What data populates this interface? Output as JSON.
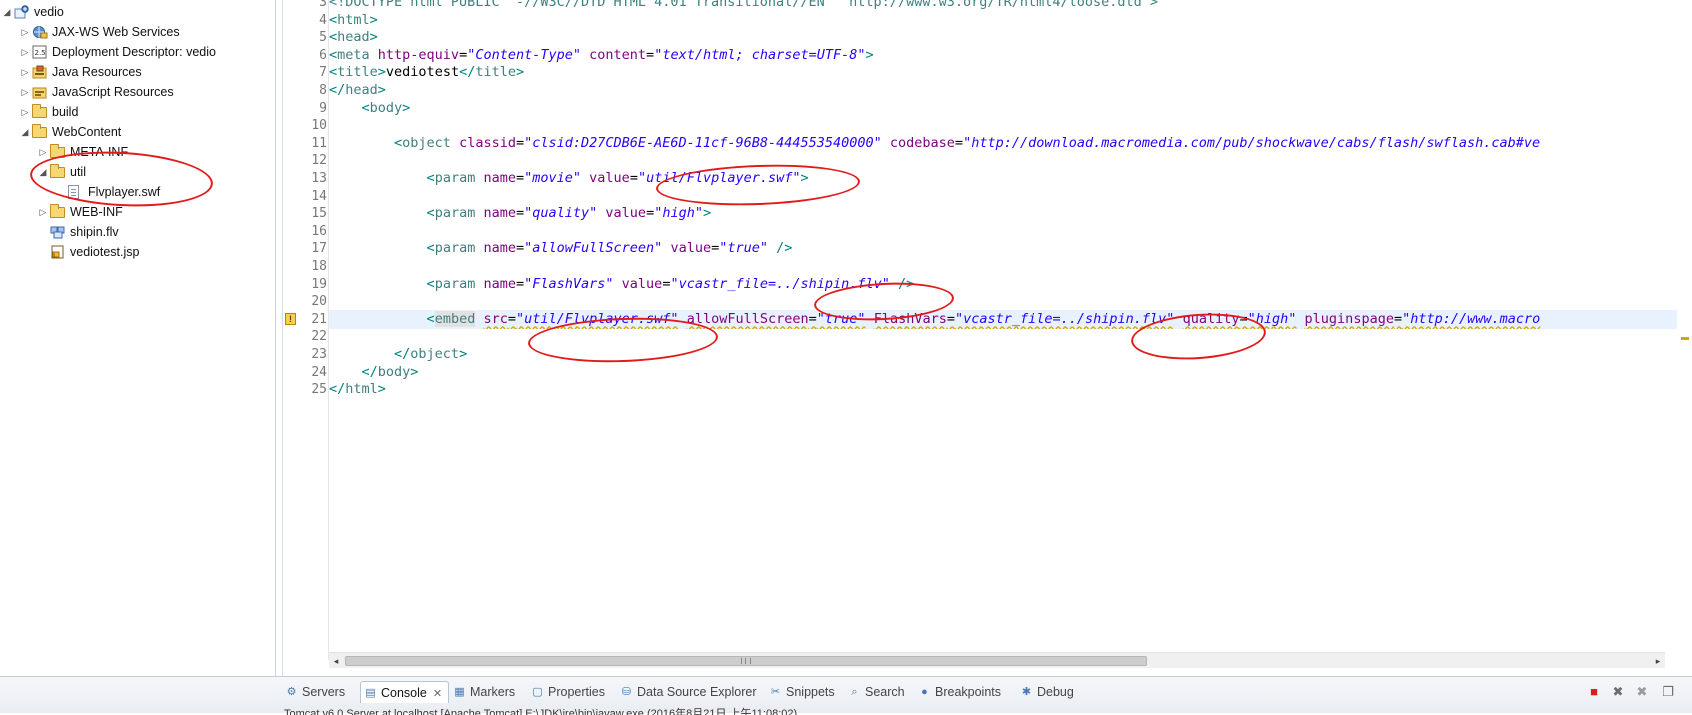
{
  "explorer": {
    "items": [
      {
        "label": "vedio",
        "icon": "project-icon",
        "twisty": "expanded"
      },
      {
        "label": "JAX-WS Web Services",
        "icon": "webservice-icon",
        "twisty": "collapsed"
      },
      {
        "label": "Deployment Descriptor: vedio",
        "icon": "descriptor-icon",
        "twisty": "collapsed"
      },
      {
        "label": "Java Resources",
        "icon": "java-resources-icon",
        "twisty": "collapsed"
      },
      {
        "label": "JavaScript Resources",
        "icon": "javascript-resources-icon",
        "twisty": "collapsed"
      },
      {
        "label": "build",
        "icon": "folder-icon",
        "twisty": "collapsed"
      },
      {
        "label": "WebContent",
        "icon": "folder-icon",
        "twisty": "expanded"
      },
      {
        "label": "META-INF",
        "icon": "folder-icon",
        "twisty": "collapsed"
      },
      {
        "label": "util",
        "icon": "folder-icon",
        "twisty": "expanded"
      },
      {
        "label": "Flvplayer.swf",
        "icon": "file-icon",
        "twisty": "none"
      },
      {
        "label": "WEB-INF",
        "icon": "folder-icon",
        "twisty": "collapsed"
      },
      {
        "label": "shipin.flv",
        "icon": "media-file-icon",
        "twisty": "none"
      },
      {
        "label": "vediotest.jsp",
        "icon": "jsp-file-icon",
        "twisty": "none"
      }
    ]
  },
  "editor": {
    "top_partial": "<!DOCTYPE html PUBLIC \"-//W3C//DTD HTML 4.01 Transitional//EN\" \"http://www.w3.org/TR/html4/loose.dtd\">",
    "line_numbers": [
      "3",
      "4",
      "5",
      "6",
      "7",
      "8",
      "9",
      "10",
      "11",
      "12",
      "13",
      "14",
      "15",
      "16",
      "17",
      "18",
      "19",
      "20",
      "21",
      "22",
      "23",
      "24",
      "25"
    ],
    "current_line": "21",
    "lines": [
      {
        "num": "4",
        "tokens": [
          [
            "bracket",
            "<"
          ],
          [
            "tag",
            "html"
          ],
          [
            "bracket",
            ">"
          ]
        ]
      },
      {
        "num": "5",
        "tokens": [
          [
            "bracket",
            "<"
          ],
          [
            "tag",
            "head"
          ],
          [
            "bracket",
            ">"
          ]
        ]
      },
      {
        "num": "6",
        "tokens": [
          [
            "bracket",
            "<"
          ],
          [
            "tag",
            "meta "
          ],
          [
            "attr",
            "http-equiv"
          ],
          [
            "eq",
            "="
          ],
          [
            "str",
            "\"Content-Type\""
          ],
          [
            "text",
            " "
          ],
          [
            "attr",
            "content"
          ],
          [
            "eq",
            "="
          ],
          [
            "str",
            "\"text/html; charset=UTF-8\""
          ],
          [
            "bracket",
            ">"
          ]
        ]
      },
      {
        "num": "7",
        "tokens": [
          [
            "bracket",
            "<"
          ],
          [
            "tag",
            "title"
          ],
          [
            "bracket",
            ">"
          ],
          [
            "text",
            "vediotest"
          ],
          [
            "bracket",
            "</"
          ],
          [
            "tag",
            "title"
          ],
          [
            "bracket",
            ">"
          ]
        ]
      },
      {
        "num": "8",
        "tokens": [
          [
            "bracket",
            "</"
          ],
          [
            "tag",
            "head"
          ],
          [
            "bracket",
            ">"
          ]
        ]
      },
      {
        "num": "9",
        "tokens": [
          [
            "text",
            "    "
          ],
          [
            "bracket",
            "<"
          ],
          [
            "tag",
            "body"
          ],
          [
            "bracket",
            ">"
          ]
        ]
      },
      {
        "num": "10",
        "tokens": []
      },
      {
        "num": "11",
        "tokens": [
          [
            "text",
            "        "
          ],
          [
            "bracket",
            "<"
          ],
          [
            "tag",
            "object "
          ],
          [
            "attr",
            "classid"
          ],
          [
            "eq",
            "="
          ],
          [
            "str",
            "\"clsid:D27CDB6E-AE6D-11cf-96B8-444553540000\""
          ],
          [
            "text",
            " "
          ],
          [
            "attr",
            "codebase"
          ],
          [
            "eq",
            "="
          ],
          [
            "str",
            "\"http://download.macromedia.com/pub/shockwave/cabs/flash/swflash.cab#ve"
          ]
        ]
      },
      {
        "num": "12",
        "tokens": []
      },
      {
        "num": "13",
        "tokens": [
          [
            "text",
            "            "
          ],
          [
            "bracket",
            "<"
          ],
          [
            "tag",
            "param "
          ],
          [
            "attr",
            "name"
          ],
          [
            "eq",
            "="
          ],
          [
            "str",
            "\"movie\""
          ],
          [
            "text",
            " "
          ],
          [
            "attr",
            "value"
          ],
          [
            "eq",
            "="
          ],
          [
            "str",
            "\"util/Flvplayer.swf\""
          ],
          [
            "bracket",
            ">"
          ]
        ]
      },
      {
        "num": "14",
        "tokens": []
      },
      {
        "num": "15",
        "tokens": [
          [
            "text",
            "            "
          ],
          [
            "bracket",
            "<"
          ],
          [
            "tag",
            "param "
          ],
          [
            "attr",
            "name"
          ],
          [
            "eq",
            "="
          ],
          [
            "str",
            "\"quality\""
          ],
          [
            "text",
            " "
          ],
          [
            "attr",
            "value"
          ],
          [
            "eq",
            "="
          ],
          [
            "str",
            "\"high\""
          ],
          [
            "bracket",
            ">"
          ]
        ]
      },
      {
        "num": "16",
        "tokens": []
      },
      {
        "num": "17",
        "tokens": [
          [
            "text",
            "            "
          ],
          [
            "bracket",
            "<"
          ],
          [
            "tag",
            "param "
          ],
          [
            "attr",
            "name"
          ],
          [
            "eq",
            "="
          ],
          [
            "str",
            "\"allowFullScreen\""
          ],
          [
            "text",
            " "
          ],
          [
            "attr",
            "value"
          ],
          [
            "eq",
            "="
          ],
          [
            "str",
            "\"true\""
          ],
          [
            "text",
            " "
          ],
          [
            "bracket",
            "/>"
          ]
        ]
      },
      {
        "num": "18",
        "tokens": []
      },
      {
        "num": "19",
        "tokens": [
          [
            "text",
            "            "
          ],
          [
            "bracket",
            "<"
          ],
          [
            "tag",
            "param "
          ],
          [
            "attr",
            "name"
          ],
          [
            "eq",
            "="
          ],
          [
            "str",
            "\"FlashVars\""
          ],
          [
            "text",
            " "
          ],
          [
            "attr",
            "value"
          ],
          [
            "eq",
            "="
          ],
          [
            "str",
            "\"vcastr_file=../shipin.flv\""
          ],
          [
            "text",
            " "
          ],
          [
            "bracket",
            "/>"
          ]
        ]
      },
      {
        "num": "20",
        "tokens": []
      },
      {
        "num": "21",
        "tokens": [
          [
            "text",
            "            "
          ],
          [
            "bracket",
            "<"
          ],
          [
            "embed",
            "embed"
          ],
          [
            "text",
            " "
          ],
          [
            "attrw",
            "src"
          ],
          [
            "eqw",
            "="
          ],
          [
            "strw",
            "\"util/Flvplayer.swf\""
          ],
          [
            "text",
            " "
          ],
          [
            "attrw",
            "allowFullScreen"
          ],
          [
            "eqw",
            "="
          ],
          [
            "strw",
            "\"true\""
          ],
          [
            "text",
            " "
          ],
          [
            "attrw",
            "FlashVars"
          ],
          [
            "eqw",
            "="
          ],
          [
            "strw",
            "\"vcastr_file=../shipin.flv\""
          ],
          [
            "text",
            " "
          ],
          [
            "attrw",
            "quality"
          ],
          [
            "eqw",
            "="
          ],
          [
            "strw",
            "\"high\""
          ],
          [
            "text",
            " "
          ],
          [
            "attrw",
            "pluginspage"
          ],
          [
            "eqw",
            "="
          ],
          [
            "strw",
            "\"http://www.macro"
          ]
        ]
      },
      {
        "num": "22",
        "tokens": []
      },
      {
        "num": "23",
        "tokens": [
          [
            "text",
            "        "
          ],
          [
            "bracket",
            "</"
          ],
          [
            "tag",
            "object"
          ],
          [
            "bracket",
            ">"
          ]
        ]
      },
      {
        "num": "24",
        "tokens": [
          [
            "text",
            "    "
          ],
          [
            "bracket",
            "</"
          ],
          [
            "tag",
            "body"
          ],
          [
            "bracket",
            ">"
          ]
        ]
      },
      {
        "num": "25",
        "tokens": [
          [
            "bracket",
            "</"
          ],
          [
            "tag",
            "html"
          ],
          [
            "bracket",
            ">"
          ]
        ]
      }
    ],
    "warning_marker_icon": "warning-icon"
  },
  "views_bar": {
    "tabs": [
      {
        "label": "Servers",
        "icon": "servers-icon",
        "active": false
      },
      {
        "label": "Console",
        "icon": "console-icon",
        "active": true,
        "close": "✕"
      },
      {
        "label": "Markers",
        "icon": "markers-icon",
        "active": false
      },
      {
        "label": "Properties",
        "icon": "properties-icon",
        "active": false
      },
      {
        "label": "Data Source Explorer",
        "icon": "data-source-icon",
        "active": false
      },
      {
        "label": "Snippets",
        "icon": "snippets-icon",
        "active": false
      },
      {
        "label": "Search",
        "icon": "search-icon",
        "active": false
      },
      {
        "label": "Breakpoints",
        "icon": "breakpoints-icon",
        "active": false
      },
      {
        "label": "Debug",
        "icon": "debug-icon",
        "active": false
      }
    ],
    "tools": [
      {
        "icon": "terminate-icon",
        "color": "#d81f1f"
      },
      {
        "icon": "remove-launch-icon",
        "color": "#6b6b6b"
      },
      {
        "icon": "remove-all-icon",
        "color": "#9a9a9a"
      },
      {
        "icon": "copy-icon",
        "color": "#6b6b6b"
      }
    ],
    "console_line": "Tomcat v6.0 Server at localhost [Apache Tomcat] E:\\JDK\\jre\\bin\\javaw.exe (2016年8月21日 上午11:08:02)"
  },
  "colors": {
    "annotation": "#e11b1b",
    "string": "#2a00ff",
    "attribute": "#7f007f",
    "tag": "#3f7f7f",
    "current_line": "#e8f2fe"
  }
}
